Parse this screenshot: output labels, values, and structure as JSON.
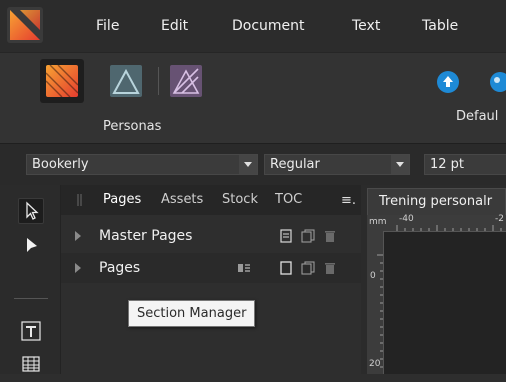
{
  "menubar": {
    "logo_icon": "affinity-publisher-logo",
    "items": [
      "File",
      "Edit",
      "Document",
      "Text",
      "Table"
    ]
  },
  "toolbar": {
    "personas": [
      {
        "name": "publisher",
        "icon": "publisher-persona-icon",
        "active": true
      },
      {
        "name": "designer",
        "icon": "designer-persona-icon",
        "active": false
      },
      {
        "name": "photo",
        "icon": "photo-persona-icon",
        "active": false
      }
    ],
    "personas_label": "Personas",
    "default_label": "Defaul"
  },
  "context": {
    "font_family": "Bookerly",
    "font_style": "Regular",
    "font_size": "12 pt"
  },
  "tools": {
    "icons": [
      "move-tool-icon",
      "node-tool-icon",
      "frame-text-tool-icon",
      "table-tool-icon"
    ]
  },
  "panel": {
    "tabs": [
      "Pages",
      "Assets",
      "Stock",
      "TOC"
    ],
    "active_tab": "Pages",
    "menu_glyph": "≡.",
    "rows": [
      {
        "label": "Master Pages"
      },
      {
        "label": "Pages"
      }
    ]
  },
  "tooltip": {
    "text": "Section Manager"
  },
  "document": {
    "tab_title": "Trening personalr",
    "ruler_unit": "mm",
    "ruler_labels": [
      "-40",
      "-2"
    ],
    "vruler_label": "0",
    "vruler_label2": "20"
  },
  "colors": {
    "accent_blue": "#1e8ad6",
    "menubar_bg": "#2c2c2c",
    "tooltip_bg": "#f4f4f4"
  }
}
